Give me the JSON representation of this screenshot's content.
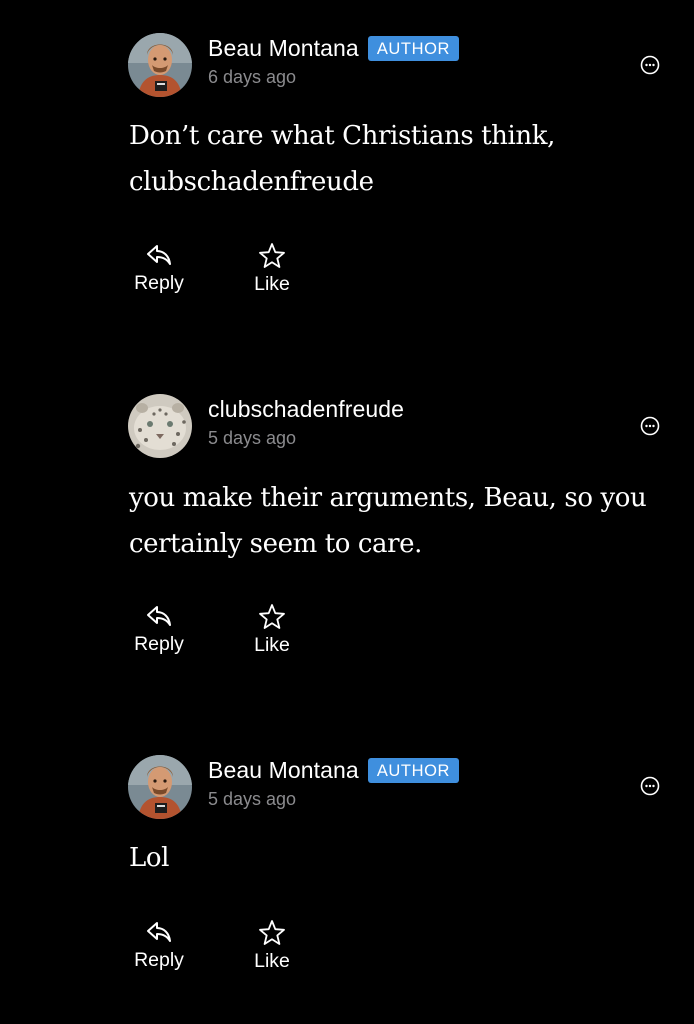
{
  "comments": [
    {
      "author": "Beau Montana",
      "badge": "AUTHOR",
      "time": "6 days ago",
      "text": "Don’t care what Christians think, clubschadenfreude",
      "avatar_icon": "man-portrait-avatar",
      "reply_label": "Reply",
      "like_label": "Like"
    },
    {
      "author": "clubschadenfreude",
      "badge": "",
      "time": "5 days ago",
      "text": "you make their arguments, Beau, so you certainly seem to care.",
      "avatar_icon": "snow-leopard-avatar",
      "reply_label": "Reply",
      "like_label": "Like"
    },
    {
      "author": "Beau Montana",
      "badge": "AUTHOR",
      "time": "5 days ago",
      "text": "Lol",
      "avatar_icon": "man-portrait-avatar",
      "reply_label": "Reply",
      "like_label": "Like"
    }
  ],
  "colors": {
    "background": "#000000",
    "badge": "#3f8fde",
    "timestamp": "#8b8b8e"
  }
}
